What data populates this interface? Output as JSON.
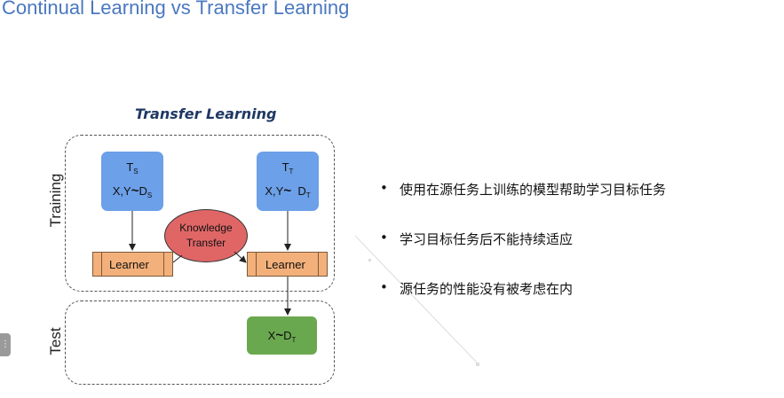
{
  "slide_title": "Continual Learning vs Transfer Learning",
  "diagram": {
    "heading": "Transfer Learning",
    "training_label": "Training",
    "test_label": "Test",
    "source_task": {
      "name": "T",
      "name_sub": "S",
      "dist": "X,Y",
      "tilde": "~",
      "dist_name": "D",
      "dist_sub": "S"
    },
    "target_task": {
      "name": "T",
      "name_sub": "T",
      "dist": "X,Y",
      "tilde": "~",
      "dist_name": "D",
      "dist_sub": "T"
    },
    "learner_left": "Learner",
    "learner_right": "Learner",
    "knowledge_line1": "Knowledge",
    "knowledge_line2": "Transfer",
    "test_box": {
      "dist": "X",
      "tilde": "~",
      "dist_name": "D",
      "dist_sub": "T"
    },
    "colors": {
      "task": "#6ca0e8",
      "learner": "#f4b07a",
      "knowledge": "#e06666",
      "test": "#6aa84f"
    }
  },
  "bullets": [
    {
      "marker": "•",
      "text": "使用在源任务上训练的模型帮助学习目标任务"
    },
    {
      "marker": "•",
      "text": "学习目标任务后不能持续适应"
    },
    {
      "marker": "•",
      "text": "源任务的性能没有被考虑在内"
    }
  ],
  "side_handle_icon": "menu-handle-icon"
}
